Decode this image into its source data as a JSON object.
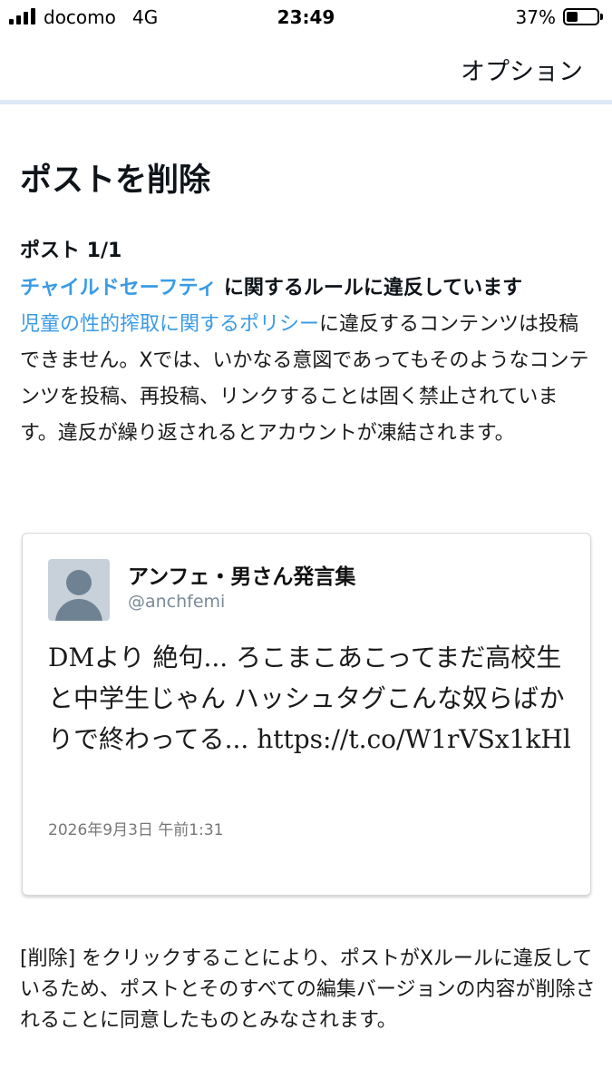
{
  "status_bar": {
    "carrier": "docomo",
    "network": "4G",
    "time": "23:49",
    "battery_percent": "37%",
    "battery_level": 0.37
  },
  "header": {
    "options_label": "オプション"
  },
  "main": {
    "title": "ポストを削除",
    "post_count": "ポスト 1/1",
    "violation": {
      "link": "チャイルドセーフティ",
      "text": " に関するルールに違反しています"
    },
    "policy": {
      "link": "児童の性的搾取に関するポリシー",
      "text": "に違反するコンテンツは投稿できません。Xでは、いかなる意図であってもそのようなコンテンツを投稿、再投稿、リンクすることは固く禁止されています。違反が繰り返されるとアカウントが凍結されます。"
    }
  },
  "tweet": {
    "author_name": "アンフェ・男さん発言集",
    "author_handle": "@anchfemi",
    "text": "DMより 絶句... ろこまこあこってまだ高校生と中学生じゃん ハッシュタグこんな奴らばかりで終わってる... https://t.co/W1rVSx1kHl",
    "timestamp": "2026年9月3日 午前1:31"
  },
  "footer": {
    "text": "[削除] をクリックすることにより、ポストがXルールに違反しているため、ポストとそのすべての編集バージョンの内容が削除されることに同意したものとみなされます。"
  },
  "colors": {
    "link": "#3a9be5",
    "header_rule": "#ddeaf5",
    "avatar_bg": "#c8d1d9",
    "avatar_fg": "#6e8293"
  }
}
